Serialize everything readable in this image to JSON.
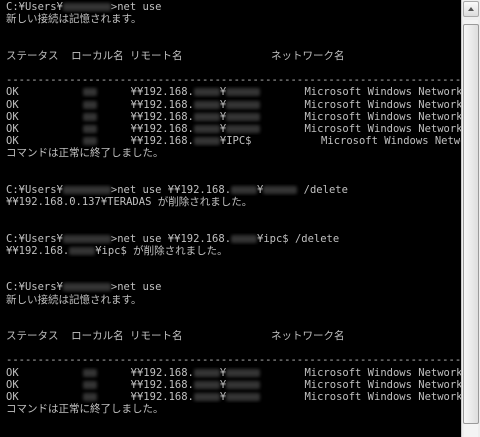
{
  "prompt": "C:¥Users¥",
  "cmd_net_use": ">net use",
  "new_connections_msg": "新しい接続は記憶されます。",
  "table_header": "ステータス  ローカル名 リモート名              ネットワーク名",
  "separator": "-------------------------------------------------------------------------------",
  "status_ok": "OK",
  "ip_prefix": "¥¥192.168.",
  "yen": "¥",
  "ipc_share": "IPC$",
  "network_name": "Microsoft Windows Network",
  "completed_msg": "コマンドは正常に終了しました。",
  "delete_cmd_1": ">net use ¥¥192.168.",
  "delete_flag": " /delete",
  "deleted_full_path": "¥¥192.168.0.137¥TERADAS が削除されました。",
  "delete_ipc_suffix": "¥ipc$ /delete",
  "deleted_ipc_prefix": "¥¥192.168.",
  "deleted_ipc_suffix": "¥ipc$ が削除されました。"
}
